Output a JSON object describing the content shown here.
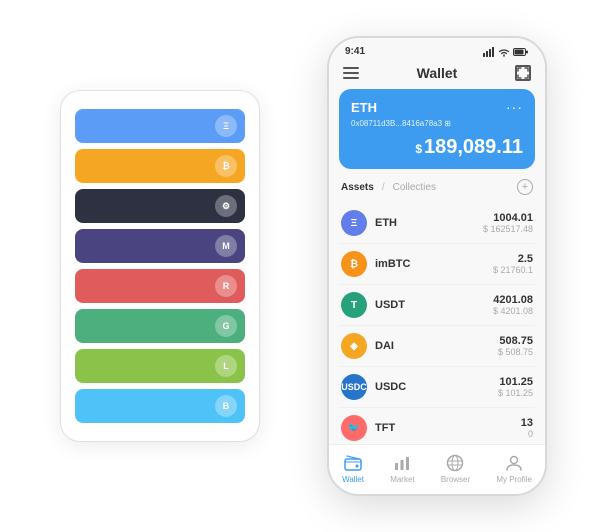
{
  "header": {
    "time": "9:41",
    "title": "Wallet"
  },
  "eth_card": {
    "label": "ETH",
    "address": "0x08711d3B...8416a78a3",
    "address_suffix": "⊞",
    "balance_symbol": "$",
    "balance": "189,089.11",
    "more_icon": "···"
  },
  "assets_section": {
    "active_tab": "Assets",
    "divider": "/",
    "inactive_tab": "Collecties",
    "add_icon": "+"
  },
  "assets": [
    {
      "symbol": "ETH",
      "icon_label": "Ξ",
      "icon_class": "asset-icon-eth",
      "amount": "1004.01",
      "usd": "$ 162517.48"
    },
    {
      "symbol": "imBTC",
      "icon_label": "₿",
      "icon_class": "asset-icon-imbtc",
      "amount": "2.5",
      "usd": "$ 21760.1"
    },
    {
      "symbol": "USDT",
      "icon_label": "T",
      "icon_class": "asset-icon-usdt",
      "amount": "4201.08",
      "usd": "$ 4201.08"
    },
    {
      "symbol": "DAI",
      "icon_label": "◈",
      "icon_class": "asset-icon-dai",
      "amount": "508.75",
      "usd": "$ 508.75"
    },
    {
      "symbol": "USDC",
      "icon_label": "$",
      "icon_class": "asset-icon-usdc",
      "amount": "101.25",
      "usd": "$ 101.25"
    },
    {
      "symbol": "TFT",
      "icon_label": "🐦",
      "icon_class": "asset-icon-tft",
      "amount": "13",
      "usd": "0"
    }
  ],
  "bottom_nav": [
    {
      "label": "Wallet",
      "active": true
    },
    {
      "label": "Market",
      "active": false
    },
    {
      "label": "Browser",
      "active": false
    },
    {
      "label": "My Profile",
      "active": false
    }
  ],
  "card_stack": [
    {
      "color": "card-blue",
      "dot": "Ξ"
    },
    {
      "color": "card-orange",
      "dot": "₿"
    },
    {
      "color": "card-dark",
      "dot": "⚙"
    },
    {
      "color": "card-purple",
      "dot": "M"
    },
    {
      "color": "card-red",
      "dot": "R"
    },
    {
      "color": "card-green",
      "dot": "G"
    },
    {
      "color": "card-light-green",
      "dot": "L"
    },
    {
      "color": "card-light-blue",
      "dot": "B"
    }
  ]
}
